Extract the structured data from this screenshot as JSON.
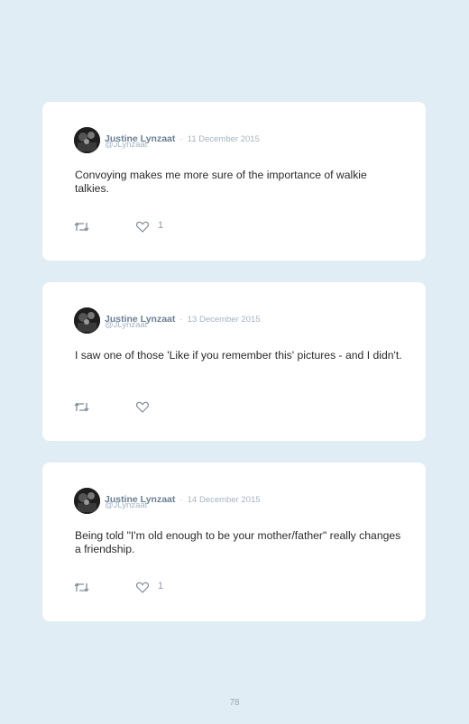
{
  "tweets": [
    {
      "author": "Justine Lynzaat",
      "separator": "·",
      "date": "11 December 2015",
      "handle": "@JLynzaat",
      "text": "Convoying makes me more sure of the importance of walkie talkies.",
      "likes": "1"
    },
    {
      "author": "Justine Lynzaat",
      "separator": "·",
      "date": "13 December 2015",
      "handle": "@JLynzaat",
      "text": "I saw one of those 'Like if you remember this' pictures - and I didn't.",
      "likes": ""
    },
    {
      "author": "Justine Lynzaat",
      "separator": "·",
      "date": "14 December 2015",
      "handle": "@JLynzaat",
      "text": "Being told \"I'm old enough to be your mother/father\" really changes a friendship.",
      "likes": "1"
    }
  ],
  "icons": {
    "retweet": "retweet-icon",
    "like": "heart-icon",
    "avatar": "avatar"
  },
  "colors": {
    "background": "#e1edf5",
    "card": "#ffffff",
    "author": "#6b8194",
    "muted": "#a4b4c2"
  },
  "page_number": "78"
}
